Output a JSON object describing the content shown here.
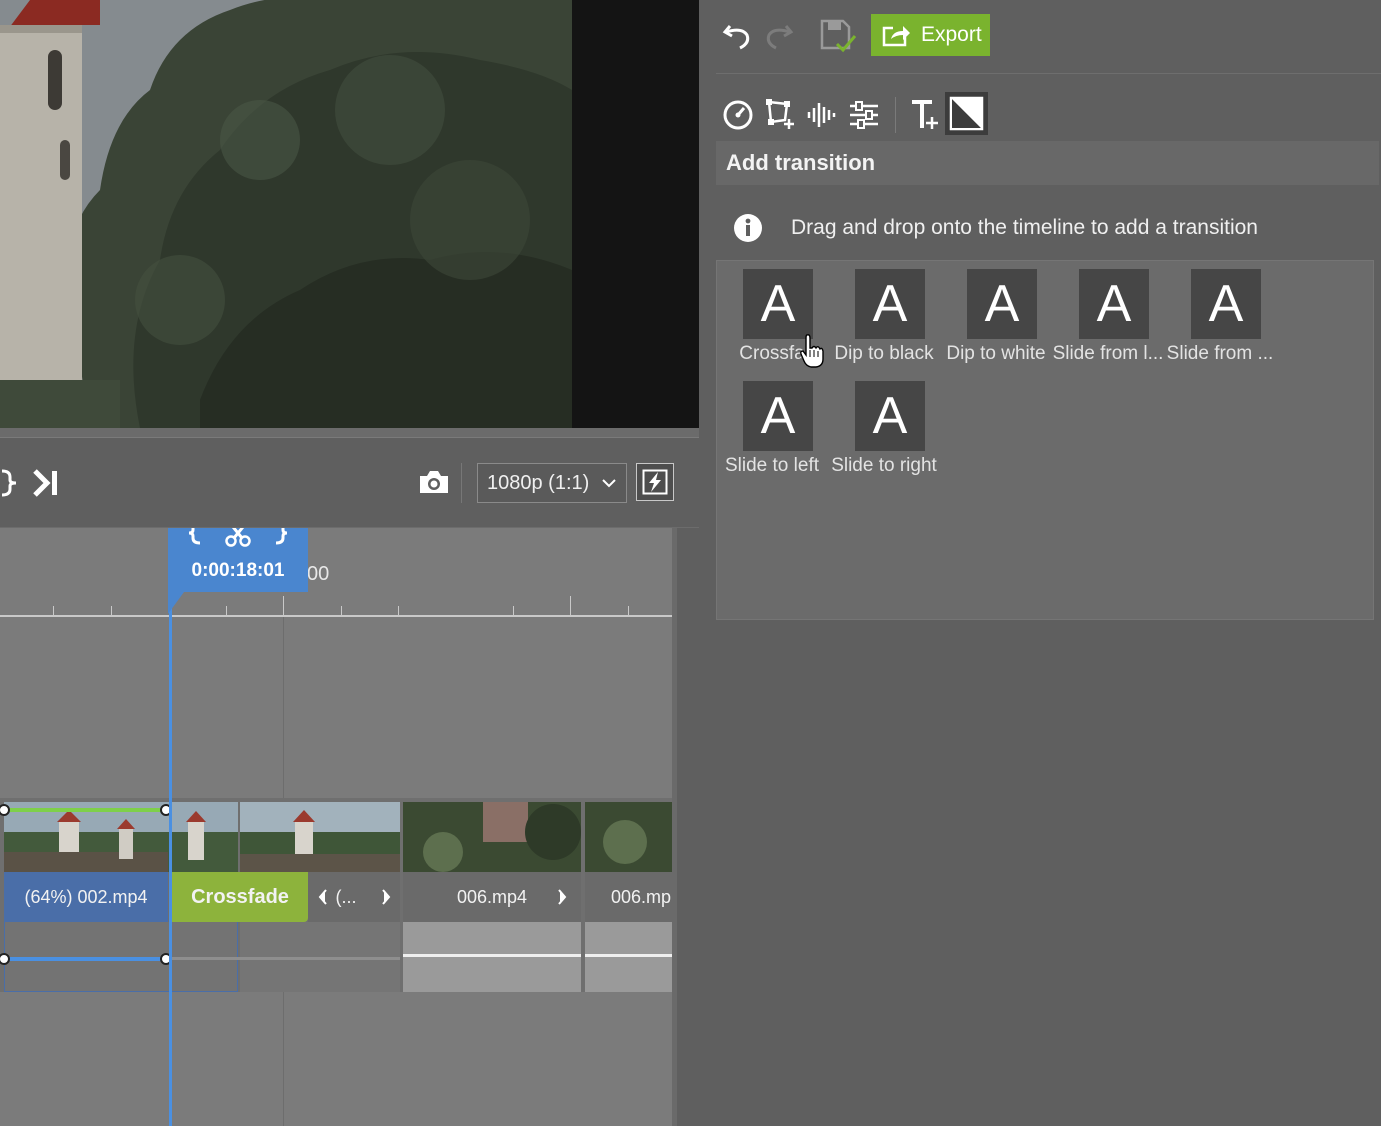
{
  "toolbar": {
    "undo_icon": "undo-icon",
    "redo_icon": "redo-icon",
    "save_icon": "save-check-icon",
    "export_label": "Export",
    "export_color": "#7ab32e"
  },
  "tools": [
    "speed-icon",
    "crop-transform-icon",
    "audio-icon",
    "adjustments-icon",
    "text-icon",
    "transition-icon"
  ],
  "section": {
    "title": "Add transition",
    "info": "Drag and drop onto the timeline to add a transition"
  },
  "transitions": [
    {
      "glyph": "A",
      "label": "Crossfa"
    },
    {
      "glyph": "A",
      "label": "Dip to black"
    },
    {
      "glyph": "A",
      "label": "Dip to white"
    },
    {
      "glyph": "A",
      "label": "Slide from l..."
    },
    {
      "glyph": "A",
      "label": "Slide from ..."
    },
    {
      "glyph": "A",
      "label": "Slide to left"
    },
    {
      "glyph": "A",
      "label": "Slide to right"
    }
  ],
  "controls": {
    "resolution": "1080p (1:1)"
  },
  "timeline": {
    "playhead_time": "0:00:18:01",
    "ruler_label": "00",
    "playhead_color": "#4a90e2",
    "clips": [
      {
        "label": "(64%) 002.mp4"
      },
      {
        "label": "Crossfade"
      },
      {
        "label": "(..."
      },
      {
        "label": "006.mp4"
      },
      {
        "label": "006.mp"
      }
    ]
  }
}
